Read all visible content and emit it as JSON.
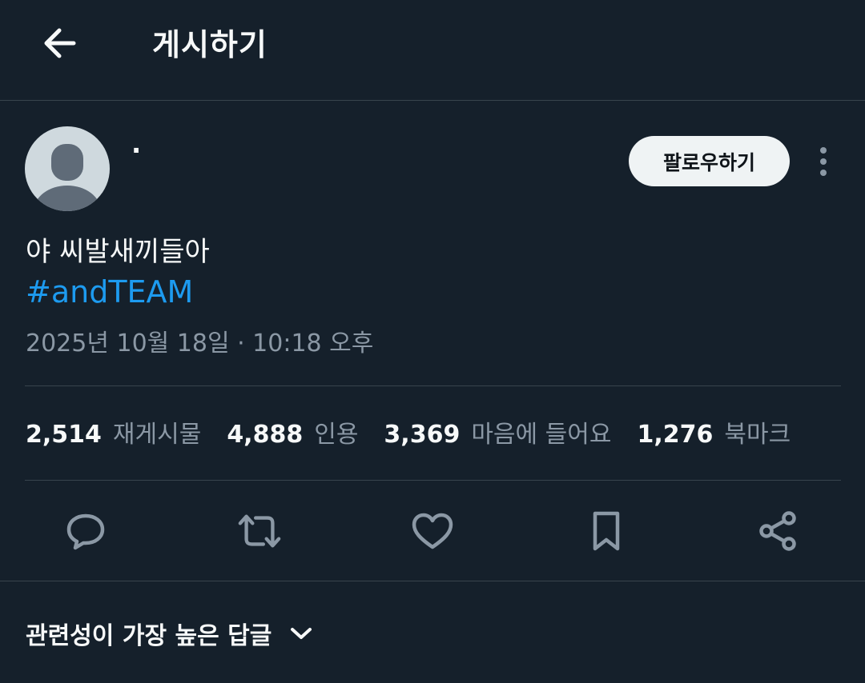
{
  "header": {
    "title": "게시하기",
    "back_icon": "arrow-left-icon"
  },
  "author": {
    "display_name": "·",
    "avatar_icon": "default-avatar-icon",
    "follow_label": "팔로우하기",
    "more_icon": "more-vertical-icon"
  },
  "post": {
    "text": "야 씨발새끼들아",
    "hashtag": "#andTEAM",
    "timestamp": "2025년 10월 18일 · 10:18 오후"
  },
  "stats": [
    {
      "count": "2,514",
      "label": "재게시물"
    },
    {
      "count": "4,888",
      "label": "인용"
    },
    {
      "count": "3,369",
      "label": "마음에 들어요"
    },
    {
      "count": "1,276",
      "label": "북마크"
    }
  ],
  "actions": [
    {
      "icon": "reply-icon"
    },
    {
      "icon": "repost-icon"
    },
    {
      "icon": "like-icon"
    },
    {
      "icon": "bookmark-icon"
    },
    {
      "icon": "share-icon"
    }
  ],
  "replies": {
    "sort_label": "관련성이 가장 높은 답글",
    "sort_icon": "chevron-down-icon"
  },
  "colors": {
    "background": "#15202b",
    "text": "#f7f9f9",
    "secondary_text": "#8b98a5",
    "accent": "#1d9bf0",
    "divider": "#38444d",
    "follow_button_bg": "#eff3f4"
  }
}
